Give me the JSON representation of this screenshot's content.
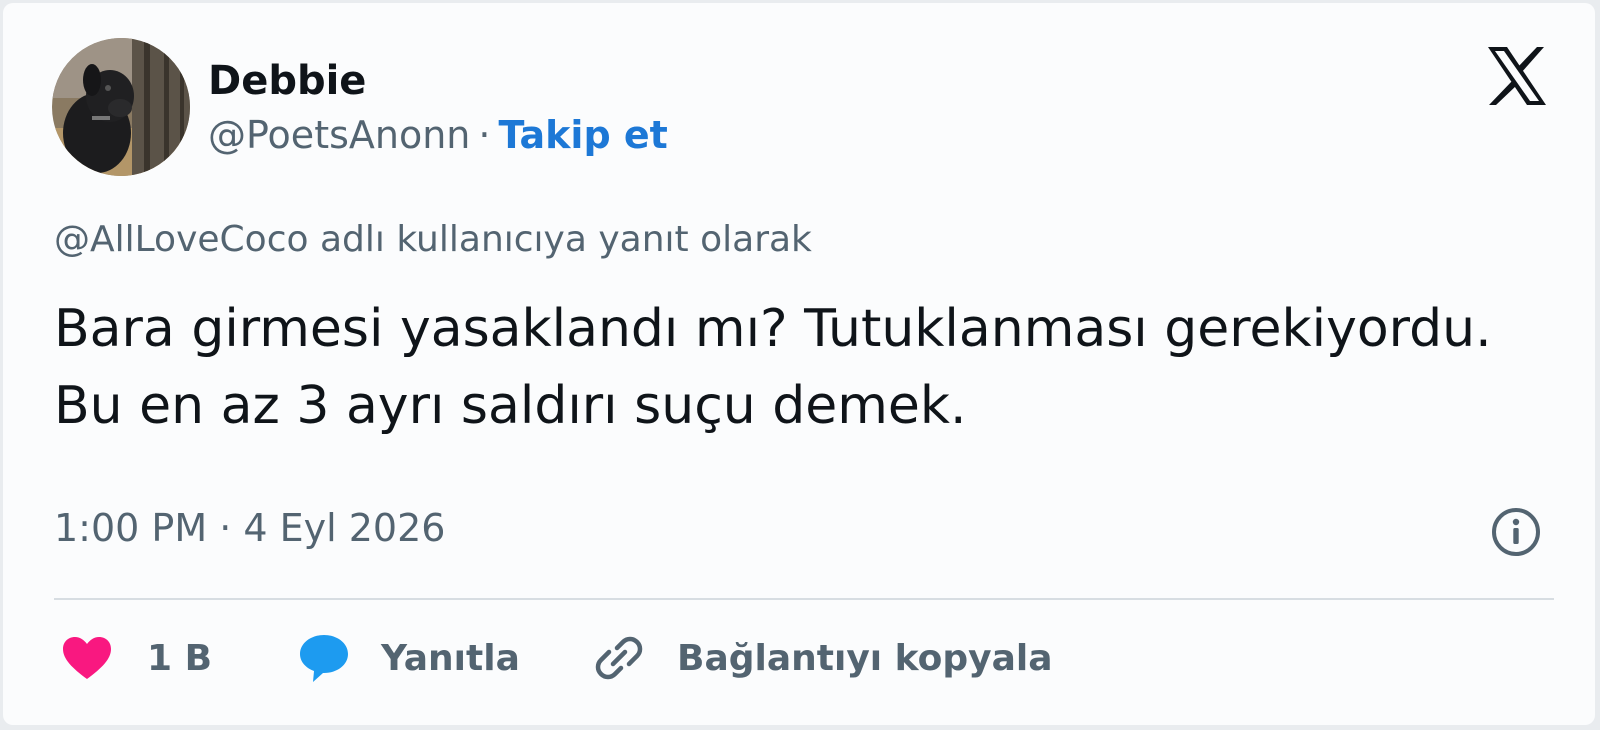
{
  "author": {
    "name": "Debbie",
    "handle": "@PoetsAnonn",
    "separator": "·",
    "follow_label": "Takip et"
  },
  "icons": {
    "logo": "x-logo-icon",
    "info": "info-icon",
    "like": "heart-icon",
    "reply": "speech-bubble-icon",
    "copy_link": "link-icon"
  },
  "tweet": {
    "reply_to": "@AllLoveCoco adlı kullanıcıya yanıt olarak",
    "text": "Bara girmesi yasaklandı mı? Tutuklanması gerekiyordu. Bu en az 3 ayrı saldırı suçu demek.",
    "timestamp": "1:00 PM · 4 Eyl 2026"
  },
  "actions": {
    "like_count": "1 B",
    "reply_label": "Yanıtla",
    "copy_link_label": "Bağlantıyı kopyala"
  },
  "colors": {
    "like": "#f91880",
    "reply": "#1d9bf0",
    "follow": "#1d78d6",
    "text": "#0f1419",
    "muted": "#536471"
  }
}
